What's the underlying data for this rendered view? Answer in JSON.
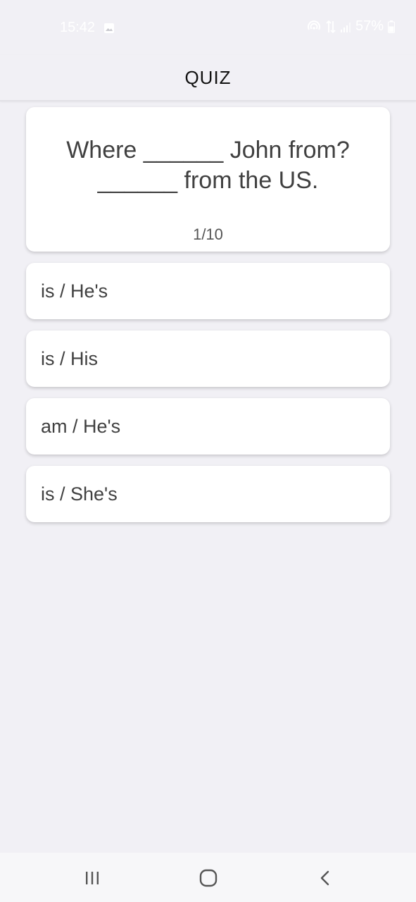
{
  "status_bar": {
    "time": "15:42",
    "battery": "57%",
    "icons": [
      "image-icon",
      "hotspot-icon",
      "data-transfer-icon",
      "signal-icon",
      "battery-icon"
    ]
  },
  "app_bar": {
    "title": "QUIZ"
  },
  "question": {
    "text": "Where ______ John from?\n______ from the US.",
    "counter": "1/10"
  },
  "options": [
    {
      "label": "is / He's"
    },
    {
      "label": "is / His"
    },
    {
      "label": "am / He's"
    },
    {
      "label": "is / She's"
    }
  ],
  "nav_bar": {
    "icons": [
      "recent-apps-icon",
      "home-icon",
      "back-icon"
    ]
  },
  "colors": {
    "background": "#f1f0f5",
    "card": "#ffffff",
    "text": "#404040"
  }
}
